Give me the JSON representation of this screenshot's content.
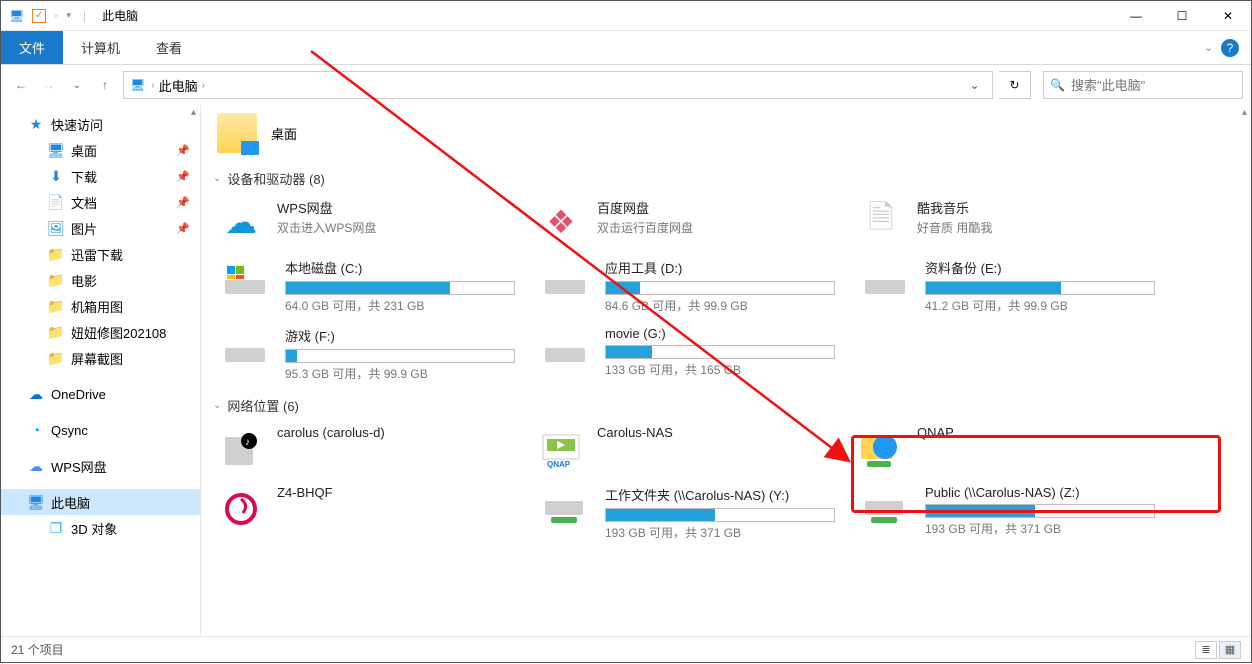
{
  "window": {
    "title": "此电脑",
    "controls": {
      "min": "—",
      "max": "☐",
      "close": "✕"
    }
  },
  "ribbon": {
    "file": "文件",
    "tabs": [
      "计算机",
      "查看"
    ],
    "help_tip": "?"
  },
  "address": {
    "crumb": "此电脑",
    "search_placeholder": "搜索\"此电脑\""
  },
  "sidebar": {
    "quick_access": "快速访问",
    "quick_items": [
      {
        "label": "桌面",
        "pinned": true,
        "icon": "🖥"
      },
      {
        "label": "下载",
        "pinned": true,
        "icon": "⬇"
      },
      {
        "label": "文档",
        "pinned": true,
        "icon": "📄"
      },
      {
        "label": "图片",
        "pinned": true,
        "icon": "🖼"
      },
      {
        "label": "迅雷下载",
        "pinned": false,
        "icon": "📁"
      },
      {
        "label": "电影",
        "pinned": false,
        "icon": "📁"
      },
      {
        "label": "机箱用图",
        "pinned": false,
        "icon": "📁"
      },
      {
        "label": "妞妞修图202108",
        "pinned": false,
        "icon": "📁"
      },
      {
        "label": "屏幕截图",
        "pinned": false,
        "icon": "📁"
      }
    ],
    "cloud_items": [
      {
        "label": "OneDrive",
        "icon": "☁",
        "color": "#0078d4"
      },
      {
        "label": "Qsync",
        "icon": "◔",
        "color": "#00aef0"
      },
      {
        "label": "WPS网盘",
        "icon": "☁",
        "color": "#4f8df5"
      }
    ],
    "this_pc": "此电脑",
    "three_d": "3D 对象"
  },
  "content": {
    "desktop_label": "桌面",
    "devices_header": "设备和驱动器 (8)",
    "cloud_drives": [
      {
        "name": "WPS网盘",
        "sub": "双击进入WPS网盘",
        "icon": "☁",
        "color": "#1296db"
      },
      {
        "name": "百度网盘",
        "sub": "双击运行百度网盘",
        "icon": "❖",
        "color": "#e94f6d"
      },
      {
        "name": "酷我音乐",
        "sub": "好音质 用酷我",
        "icon": "📄",
        "color": "#dcdcdc"
      }
    ],
    "drives": [
      {
        "name": "本地磁盘 (C:)",
        "free": "64.0 GB 可用，共 231 GB",
        "fill": 72
      },
      {
        "name": "应用工具 (D:)",
        "free": "84.6 GB 可用，共 99.9 GB",
        "fill": 15
      },
      {
        "name": "资料备份 (E:)",
        "free": "41.2 GB 可用，共 99.9 GB",
        "fill": 59
      },
      {
        "name": "游戏 (F:)",
        "free": "95.3 GB 可用，共 99.9 GB",
        "fill": 5
      },
      {
        "name": "movie (G:)",
        "free": "133 GB 可用，共 165 GB",
        "fill": 20
      }
    ],
    "network_header": "网络位置 (6)",
    "network_items": [
      {
        "name": "carolus (carolus-d)",
        "icon": "💿",
        "type": "media"
      },
      {
        "name": "Carolus-NAS",
        "icon": "▭",
        "type": "qnap"
      },
      {
        "name": "QNAP",
        "icon": "🌐",
        "type": "folder-globe"
      }
    ],
    "network_drives": [
      {
        "name": "Z4-BHQF",
        "icon": "◉",
        "type": "logo"
      },
      {
        "name": "工作文件夹 (\\\\Carolus-NAS) (Y:)",
        "free": "193 GB 可用，共 371 GB",
        "fill": 48,
        "type": "netdrive"
      },
      {
        "name": "Public (\\\\Carolus-NAS) (Z:)",
        "free": "193 GB 可用，共 371 GB",
        "fill": 48,
        "type": "netdrive"
      }
    ]
  },
  "statusbar": {
    "count": "21 个项目"
  }
}
